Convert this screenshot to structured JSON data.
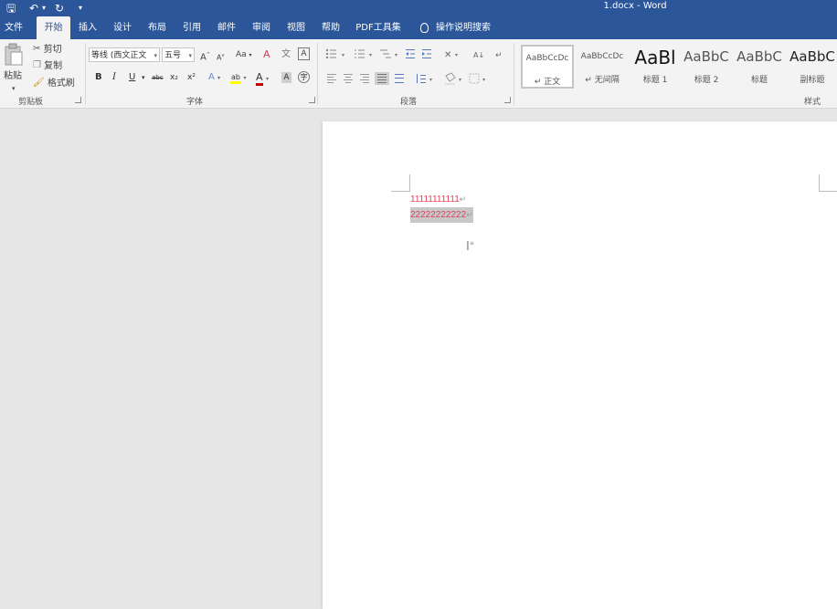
{
  "titlebar": {
    "title": "1.docx  -  Word",
    "quick_access": {
      "save": "🖫",
      "undo": "↶",
      "undo_dd": "▾",
      "redo": "↻",
      "customize": "▾"
    }
  },
  "tabs": [
    "文件",
    "开始",
    "插入",
    "设计",
    "布局",
    "引用",
    "邮件",
    "审阅",
    "视图",
    "帮助",
    "PDF工具集"
  ],
  "active_tab": "开始",
  "tell_me": "操作说明搜索",
  "clipboard": {
    "paste_label": "粘贴",
    "cut": "剪切",
    "copy": "复制",
    "format_painter": "格式刷",
    "group_label": "剪贴板"
  },
  "font": {
    "font_name": "等线 (西文正文",
    "font_size": "五号",
    "group_label": "字体",
    "grow": "A",
    "shrink": "A",
    "change_case": "Aa",
    "bold": "B",
    "italic": "I",
    "underline": "U",
    "strike": "abc",
    "subscript": "x₂",
    "superscript": "x²",
    "highlight": "ab",
    "font_color": "A",
    "char_shading": "A"
  },
  "paragraph": {
    "group_label": "段落"
  },
  "styles": {
    "group_label": "样式",
    "items": [
      {
        "preview": "AaBbCcDc",
        "name": "↵ 正文"
      },
      {
        "preview": "AaBbCcDc",
        "name": "↵ 无间隔"
      },
      {
        "preview": "AaBl",
        "name": "标题 1"
      },
      {
        "preview": "AaBbC",
        "name": "标题 2"
      },
      {
        "preview": "AaBbC",
        "name": "标题"
      },
      {
        "preview": "AaBbC",
        "name": "副标题"
      }
    ]
  },
  "document": {
    "line1": "11111111111",
    "line2": "22222222222",
    "paragraph_mark": "↵"
  },
  "colors": {
    "ribbon_blue": "#2b579a",
    "doc_text": "#e0405a",
    "selection": "#c8c8c8",
    "highlight_yellow": "#ffff00",
    "font_color_red": "#c00000"
  }
}
